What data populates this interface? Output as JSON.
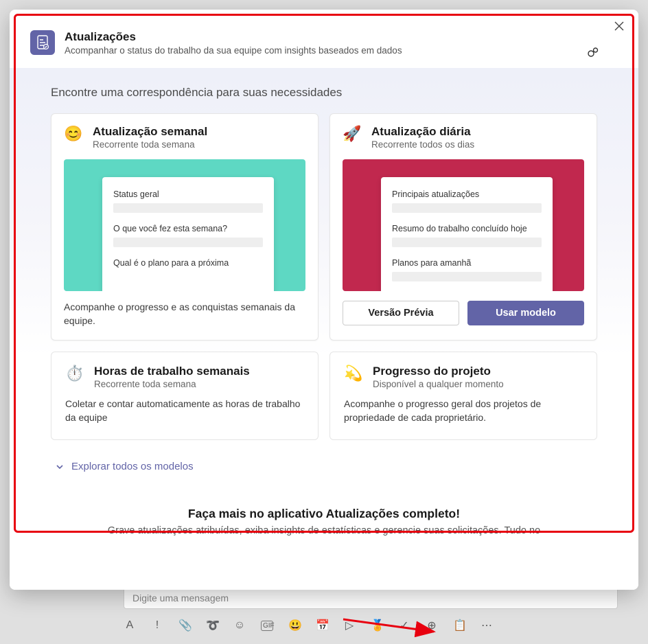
{
  "header": {
    "title": "Atualizações",
    "subtitle": "Acompanhar o status do trabalho da sua equipe com insights baseados em dados"
  },
  "section_title": "Encontre uma correspondência para suas necessidades",
  "cards": {
    "weekly": {
      "emoji": "😊",
      "title": "Atualização semanal",
      "sub": "Recorrente toda semana",
      "fields": [
        "Status geral",
        "O que você fez esta semana?",
        "Qual é o plano para a próxima"
      ],
      "desc": "Acompanhe o progresso e as conquistas semanais da equipe."
    },
    "daily": {
      "emoji": "🚀",
      "title": "Atualização diária",
      "sub": "Recorrente todos os dias",
      "fields": [
        "Principais atualizações",
        "Resumo do trabalho concluído hoje",
        "Planos para amanhã"
      ],
      "preview_btn": "Versão Prévia",
      "use_btn": "Usar modelo"
    },
    "hours": {
      "emoji": "⏱️",
      "title": "Horas de trabalho semanais",
      "sub": "Recorrente toda semana",
      "desc": "Coletar e contar automaticamente as horas de trabalho da equipe"
    },
    "project": {
      "emoji": "💫",
      "title": "Progresso do projeto",
      "sub": "Disponível a qualquer momento",
      "desc": "Acompanhe o progresso geral dos projetos de propriedade de cada proprietário."
    }
  },
  "explore": "Explorar todos os modelos",
  "footer": {
    "title": "Faça mais no aplicativo Atualizações completo!",
    "sub": "Grave atualizações atribuídas, exiba insights de estatísticas e gerencie suas solicitações. Tudo no"
  },
  "compose_placeholder": "Digite uma mensagem"
}
